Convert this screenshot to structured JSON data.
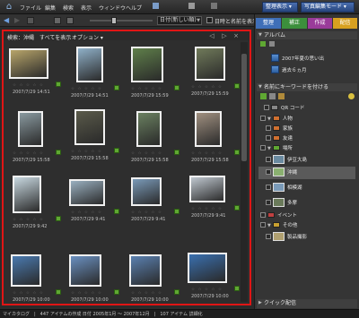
{
  "menubar": {
    "home_icon": "home-icon",
    "menus": [
      "ファイル",
      "編集",
      "検索",
      "表示",
      "ウィンドウ",
      "ヘルプ"
    ],
    "search_btn": "",
    "undo_label": "",
    "display_btn": "整理表示 ▾",
    "editmode_btn": "写真編集モード ▾"
  },
  "toolbar2": {
    "sort_value": "日付(新しい順)",
    "detail_label": "日時と名前を表示"
  },
  "photo_panel": {
    "header_search": "検索：沖縄",
    "header_show_all": "すべてを表示",
    "header_options": "オプション ▾",
    "photos": [
      {
        "date": "2007/7/29 14:51",
        "stars": "☆ ☆ ☆ ☆ ☆"
      },
      {
        "date": "2007/7/29 14:51",
        "stars": "☆ ☆ ☆ ☆ ☆"
      },
      {
        "date": "2007/7/29 15:59",
        "stars": "☆ ☆ ☆ ☆ ☆"
      },
      {
        "date": "2007/7/29 15:59",
        "stars": "☆ ☆ ☆ ☆ ☆"
      },
      {
        "date": "2007/7/29 15:58",
        "stars": "☆ ☆ ☆ ☆ ☆"
      },
      {
        "date": "2007/7/29 15:58",
        "stars": "☆ ☆ ☆ ☆ ☆"
      },
      {
        "date": "2007/7/29 15:58",
        "stars": "☆ ☆ ☆ ☆ ☆"
      },
      {
        "date": "2007/7/29 15:58",
        "stars": "☆ ☆ ☆ ☆ ☆"
      },
      {
        "date": "2007/7/29 9:42",
        "stars": "☆ ☆ ☆ ☆ ☆"
      },
      {
        "date": "2007/7/29 9:41",
        "stars": "☆ ☆ ☆ ☆ ☆"
      },
      {
        "date": "2007/7/29 9:41",
        "stars": "☆ ☆ ☆ ☆ ☆"
      },
      {
        "date": "2007/7/29 9:41",
        "stars": "☆ ☆ ☆ ☆ ☆"
      },
      {
        "date": "2007/7/29 10:00",
        "stars": "☆ ☆ ☆ ☆ ☆"
      },
      {
        "date": "2007/7/29 10:00",
        "stars": "☆ ☆ ☆ ☆ ☆"
      },
      {
        "date": "2007/7/29 10:00",
        "stars": "☆ ☆ ☆ ☆ ☆"
      },
      {
        "date": "2007/7/29 10:00",
        "stars": "☆ ☆ ☆ ☆ ☆"
      }
    ]
  },
  "right_panel": {
    "tabs": [
      "整理",
      "補正",
      "作成",
      "配信"
    ],
    "album_header": "アルバム",
    "albums": [
      "2007年夏の思い出",
      "過去６ヵ月"
    ],
    "tags_header": "名前にキーワードを付ける",
    "tags": [
      "QR コード",
      "人物",
      "家族",
      "友達",
      "場所",
      "伊豆大島",
      "沖縄",
      "相模湖",
      "多摩",
      "イベント",
      "その他",
      "製品撮影"
    ],
    "quick_share": "クイック配信"
  },
  "status": {
    "text": "マイカタログ　|　447 アイテムの作成 日付 2005年1月 ～ 2007年12月　|　107 アイテム 詳細化"
  },
  "colors": {
    "highlight_border": "#e01515",
    "tab_organize": "#3f6fb8",
    "tab_fix": "#3c8f3c",
    "tab_create": "#9a3b9a",
    "tab_share": "#d7a020",
    "tag_green": "#5fa832"
  }
}
